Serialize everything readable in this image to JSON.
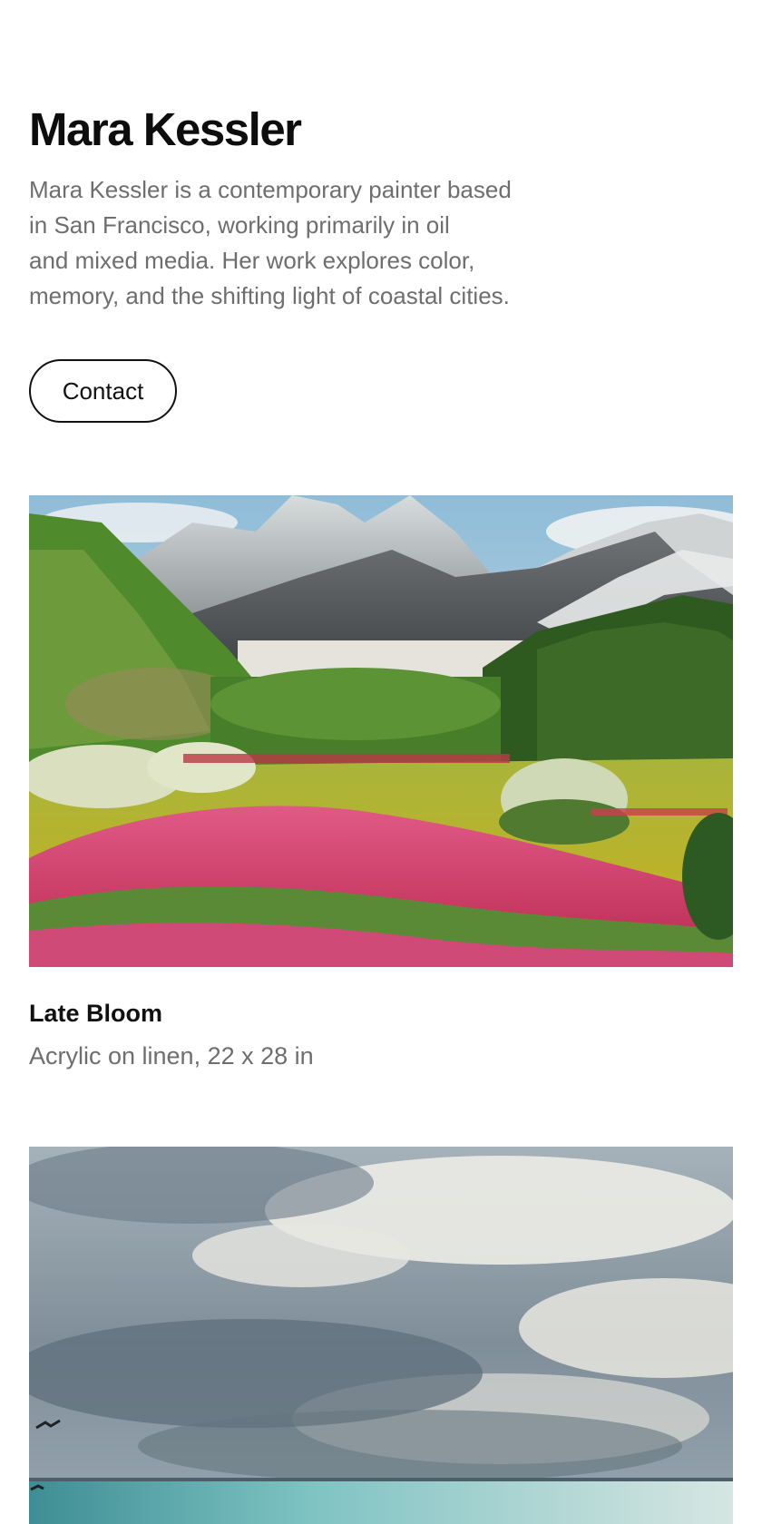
{
  "artist": {
    "name": "Mara Kessler",
    "bio": "Mara Kessler is a contemporary painter based\nin San Francisco, working primarily in oil\nand mixed media. Her work explores color,\nmemory, and the shifting light of coastal cities."
  },
  "contact": {
    "label": "Contact"
  },
  "artworks": [
    {
      "title": "Late Bloom",
      "details": "Acrylic on linen, 22 x 28 in",
      "subject": "mountain meadow with pink flowers"
    },
    {
      "subject": "stormy sky over the sea, watercolor"
    }
  ]
}
